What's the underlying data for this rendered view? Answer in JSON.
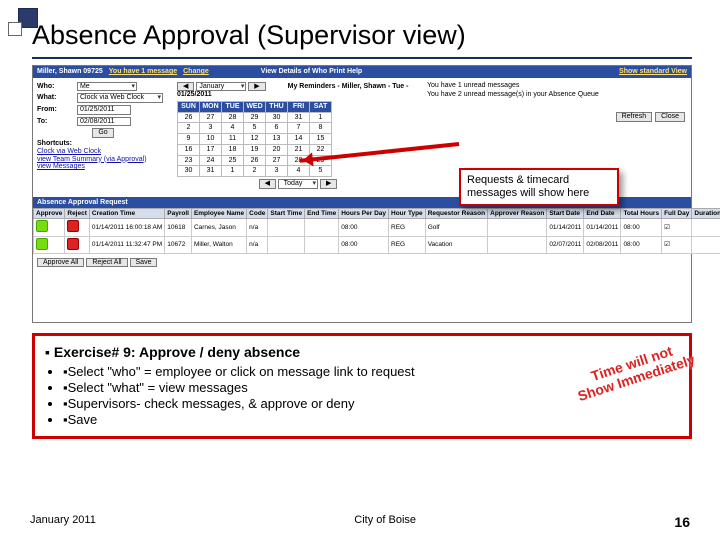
{
  "slide": {
    "title": "Absence Approval (Supervisor view)",
    "footer_left": "January 2011",
    "footer_center": "City of Boise",
    "footer_right": "16"
  },
  "header": {
    "user": "Miller, Shawn 09725",
    "msg_link": "You have 1 message",
    "change": "Change",
    "actions": "View Details of Who  Print  Help",
    "show_standard": "Show standard View",
    "reminders_title": "My Reminders - Miller, Shawn - Tue - 01/25/2011"
  },
  "filters": {
    "who_label": "Who:",
    "who_value": "Me",
    "what_label": "What:",
    "what_value": "Clock via Web Clock",
    "from_label": "From:",
    "from_value": "01/25/2011",
    "to_label": "To:",
    "to_value": "02/08/2011",
    "go": "Go",
    "shortcuts_label": "Shortcuts:",
    "shortcut1": "Clock via Web Clock",
    "shortcut2": "view Team Summary (via Approval)",
    "shortcut3": "view Messages"
  },
  "calendar": {
    "month": "January",
    "dow": [
      "SUN",
      "MON",
      "TUE",
      "WED",
      "THU",
      "FRI",
      "SAT"
    ],
    "rows": [
      [
        "26",
        "27",
        "28",
        "29",
        "30",
        "31",
        "1"
      ],
      [
        "2",
        "3",
        "4",
        "5",
        "6",
        "7",
        "8"
      ],
      [
        "9",
        "10",
        "11",
        "12",
        "13",
        "14",
        "15"
      ],
      [
        "16",
        "17",
        "18",
        "19",
        "20",
        "21",
        "22"
      ],
      [
        "23",
        "24",
        "25",
        "26",
        "27",
        "28",
        "29"
      ],
      [
        "30",
        "31",
        "1",
        "2",
        "3",
        "4",
        "5"
      ]
    ],
    "today_label": "Today"
  },
  "reminders": {
    "line1": "You have 1 unread messages",
    "line2": "You have 2 unread message(s) in your Absence Queue"
  },
  "buttons": {
    "refresh": "Refresh",
    "close": "Close"
  },
  "callout": "Requests & timecard messages will show here",
  "approval": {
    "section": "Absence Approval Request",
    "headers": [
      "Approve",
      "Reject",
      "Creation Time",
      "Payroll",
      "Employee Name",
      "Code",
      "Start Time",
      "End Time",
      "Hours Per Day",
      "Hour Type",
      "Requestor Reason",
      "Approver Reason",
      "Start Date",
      "End Date",
      "Total Hours",
      "Full Day",
      "Duration Based"
    ],
    "rows": [
      {
        "created": "01/14/2011 16:00:18 AM",
        "payroll": "10618",
        "name": "Carnes, Jason",
        "code": "n/a",
        "hpd": "08:00",
        "htype": "REG",
        "rreason": "Golf",
        "areason": "",
        "start": "01/14/2011",
        "end": "01/14/2011",
        "total": "08:00",
        "fd": "☑",
        "db": ""
      },
      {
        "created": "01/14/2011 11:32:47 PM",
        "payroll": "10672",
        "name": "Miller, Walton",
        "code": "n/a",
        "hpd": "08:00",
        "htype": "REG",
        "rreason": "Vacation",
        "areason": "",
        "start": "02/07/2011",
        "end": "02/08/2011",
        "total": "08:00",
        "fd": "☑",
        "db": ""
      }
    ],
    "btn_approve_all": "Approve All",
    "btn_reject_all": "Reject All",
    "btn_save": "Save"
  },
  "exercise": {
    "heading": "Exercise# 9:  Approve / deny absence",
    "items": [
      "Select \"who\" = employee or click on message link to request",
      "Select \"what\" = view messages",
      "Supervisors- check messages, & approve or deny",
      "Save"
    ],
    "stamp_l1": "Time will not",
    "stamp_l2": "Show Immediately"
  }
}
